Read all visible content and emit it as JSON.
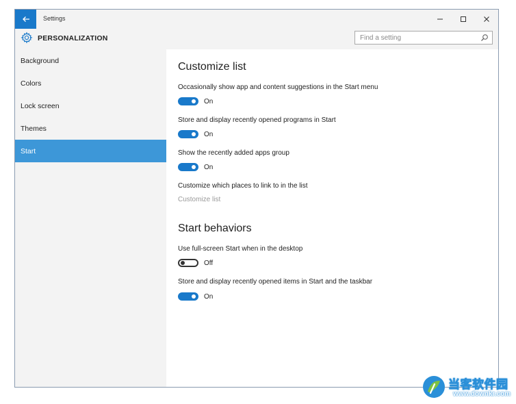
{
  "window": {
    "title": "Settings",
    "controls": {
      "minimize": "−",
      "maximize": "☐",
      "close": "✕"
    }
  },
  "header": {
    "title": "PERSONALIZATION",
    "search_placeholder": "Find a setting"
  },
  "sidebar": {
    "items": [
      {
        "label": "Background"
      },
      {
        "label": "Colors"
      },
      {
        "label": "Lock screen"
      },
      {
        "label": "Themes"
      },
      {
        "label": "Start",
        "selected": true
      }
    ]
  },
  "content": {
    "customize_list": {
      "title": "Customize list",
      "settings": [
        {
          "label": "Occasionally show app and content suggestions in the Start menu",
          "state": "On",
          "enabled": true
        },
        {
          "label": "Store and display recently opened programs in Start",
          "state": "On",
          "enabled": true
        },
        {
          "label": "Show the recently added apps group",
          "state": "On",
          "enabled": true
        }
      ],
      "places_label": "Customize which places to link to in the list",
      "places_link": "Customize list"
    },
    "start_behaviors": {
      "title": "Start behaviors",
      "settings": [
        {
          "label": "Use full-screen Start when in the desktop",
          "state": "Off",
          "enabled": false
        },
        {
          "label": "Store and display recently opened items in Start and the taskbar",
          "state": "On",
          "enabled": true
        }
      ]
    }
  },
  "watermark": {
    "name": "当客软件园",
    "url": "www.downkr.com"
  },
  "colors": {
    "accent": "#1979ca",
    "selected_nav": "#3d97d8",
    "sidebar_bg": "#f3f3f3",
    "disabled_text": "#999999"
  },
  "icons": {
    "back": "back-arrow-icon",
    "gear": "gear-icon",
    "search": "search-icon"
  }
}
